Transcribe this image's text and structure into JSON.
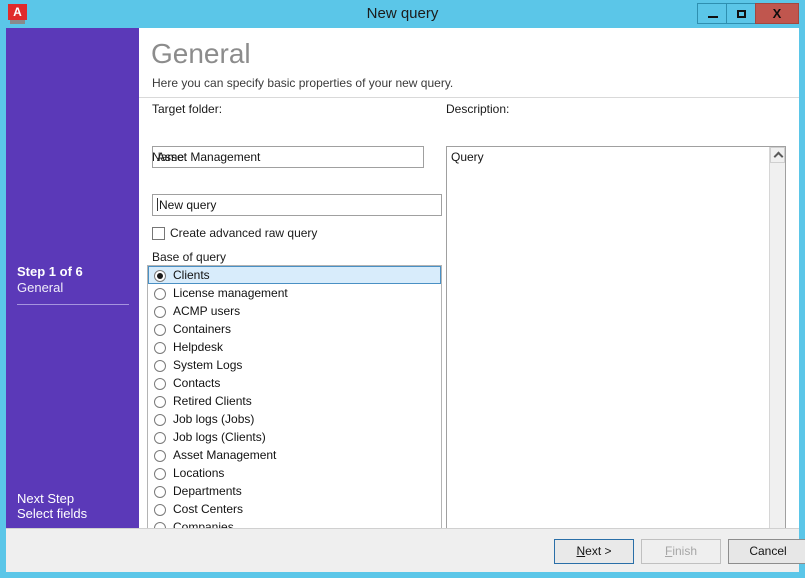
{
  "window": {
    "title": "New query",
    "app_icon": "acmp-app-icon",
    "app_icon_letter": "A",
    "controls": {
      "minimize": "minimize-button",
      "maximize": "maximize-button",
      "close_label": "X"
    },
    "accent_color": "#5bc6e8",
    "sidebar_color": "#5b39b8"
  },
  "sidebar": {
    "step_counter": "Step 1 of 6",
    "step_name": "General",
    "next_step_title": "Next Step",
    "next_step_name": "Select fields"
  },
  "header": {
    "title": "General",
    "subtitle": "Here you can specify basic properties of your new query."
  },
  "form": {
    "target_folder": {
      "label": "Target folder:",
      "value": "Asset Management",
      "browse_label": "..."
    },
    "name": {
      "label": "Name:",
      "value": "New query"
    },
    "advanced_checkbox": {
      "label": "Create advanced raw query",
      "checked": false
    },
    "base_of_query": {
      "label": "Base of query",
      "selected": "Clients",
      "options": [
        "Clients",
        "License management",
        "ACMP users",
        "Containers",
        "Helpdesk",
        "System Logs",
        "Contacts",
        "Retired Clients",
        "Job logs (Jobs)",
        "Job logs (Clients)",
        "Asset Management",
        "Locations",
        "Departments",
        "Cost Centers",
        "Companies"
      ]
    },
    "description": {
      "label": "Description:",
      "value": "Query"
    }
  },
  "footer": {
    "next_label": "Next >",
    "next_accesskey": "N",
    "finish_label": "Finish",
    "finish_accesskey": "F",
    "finish_enabled": false,
    "cancel_label": "Cancel"
  }
}
